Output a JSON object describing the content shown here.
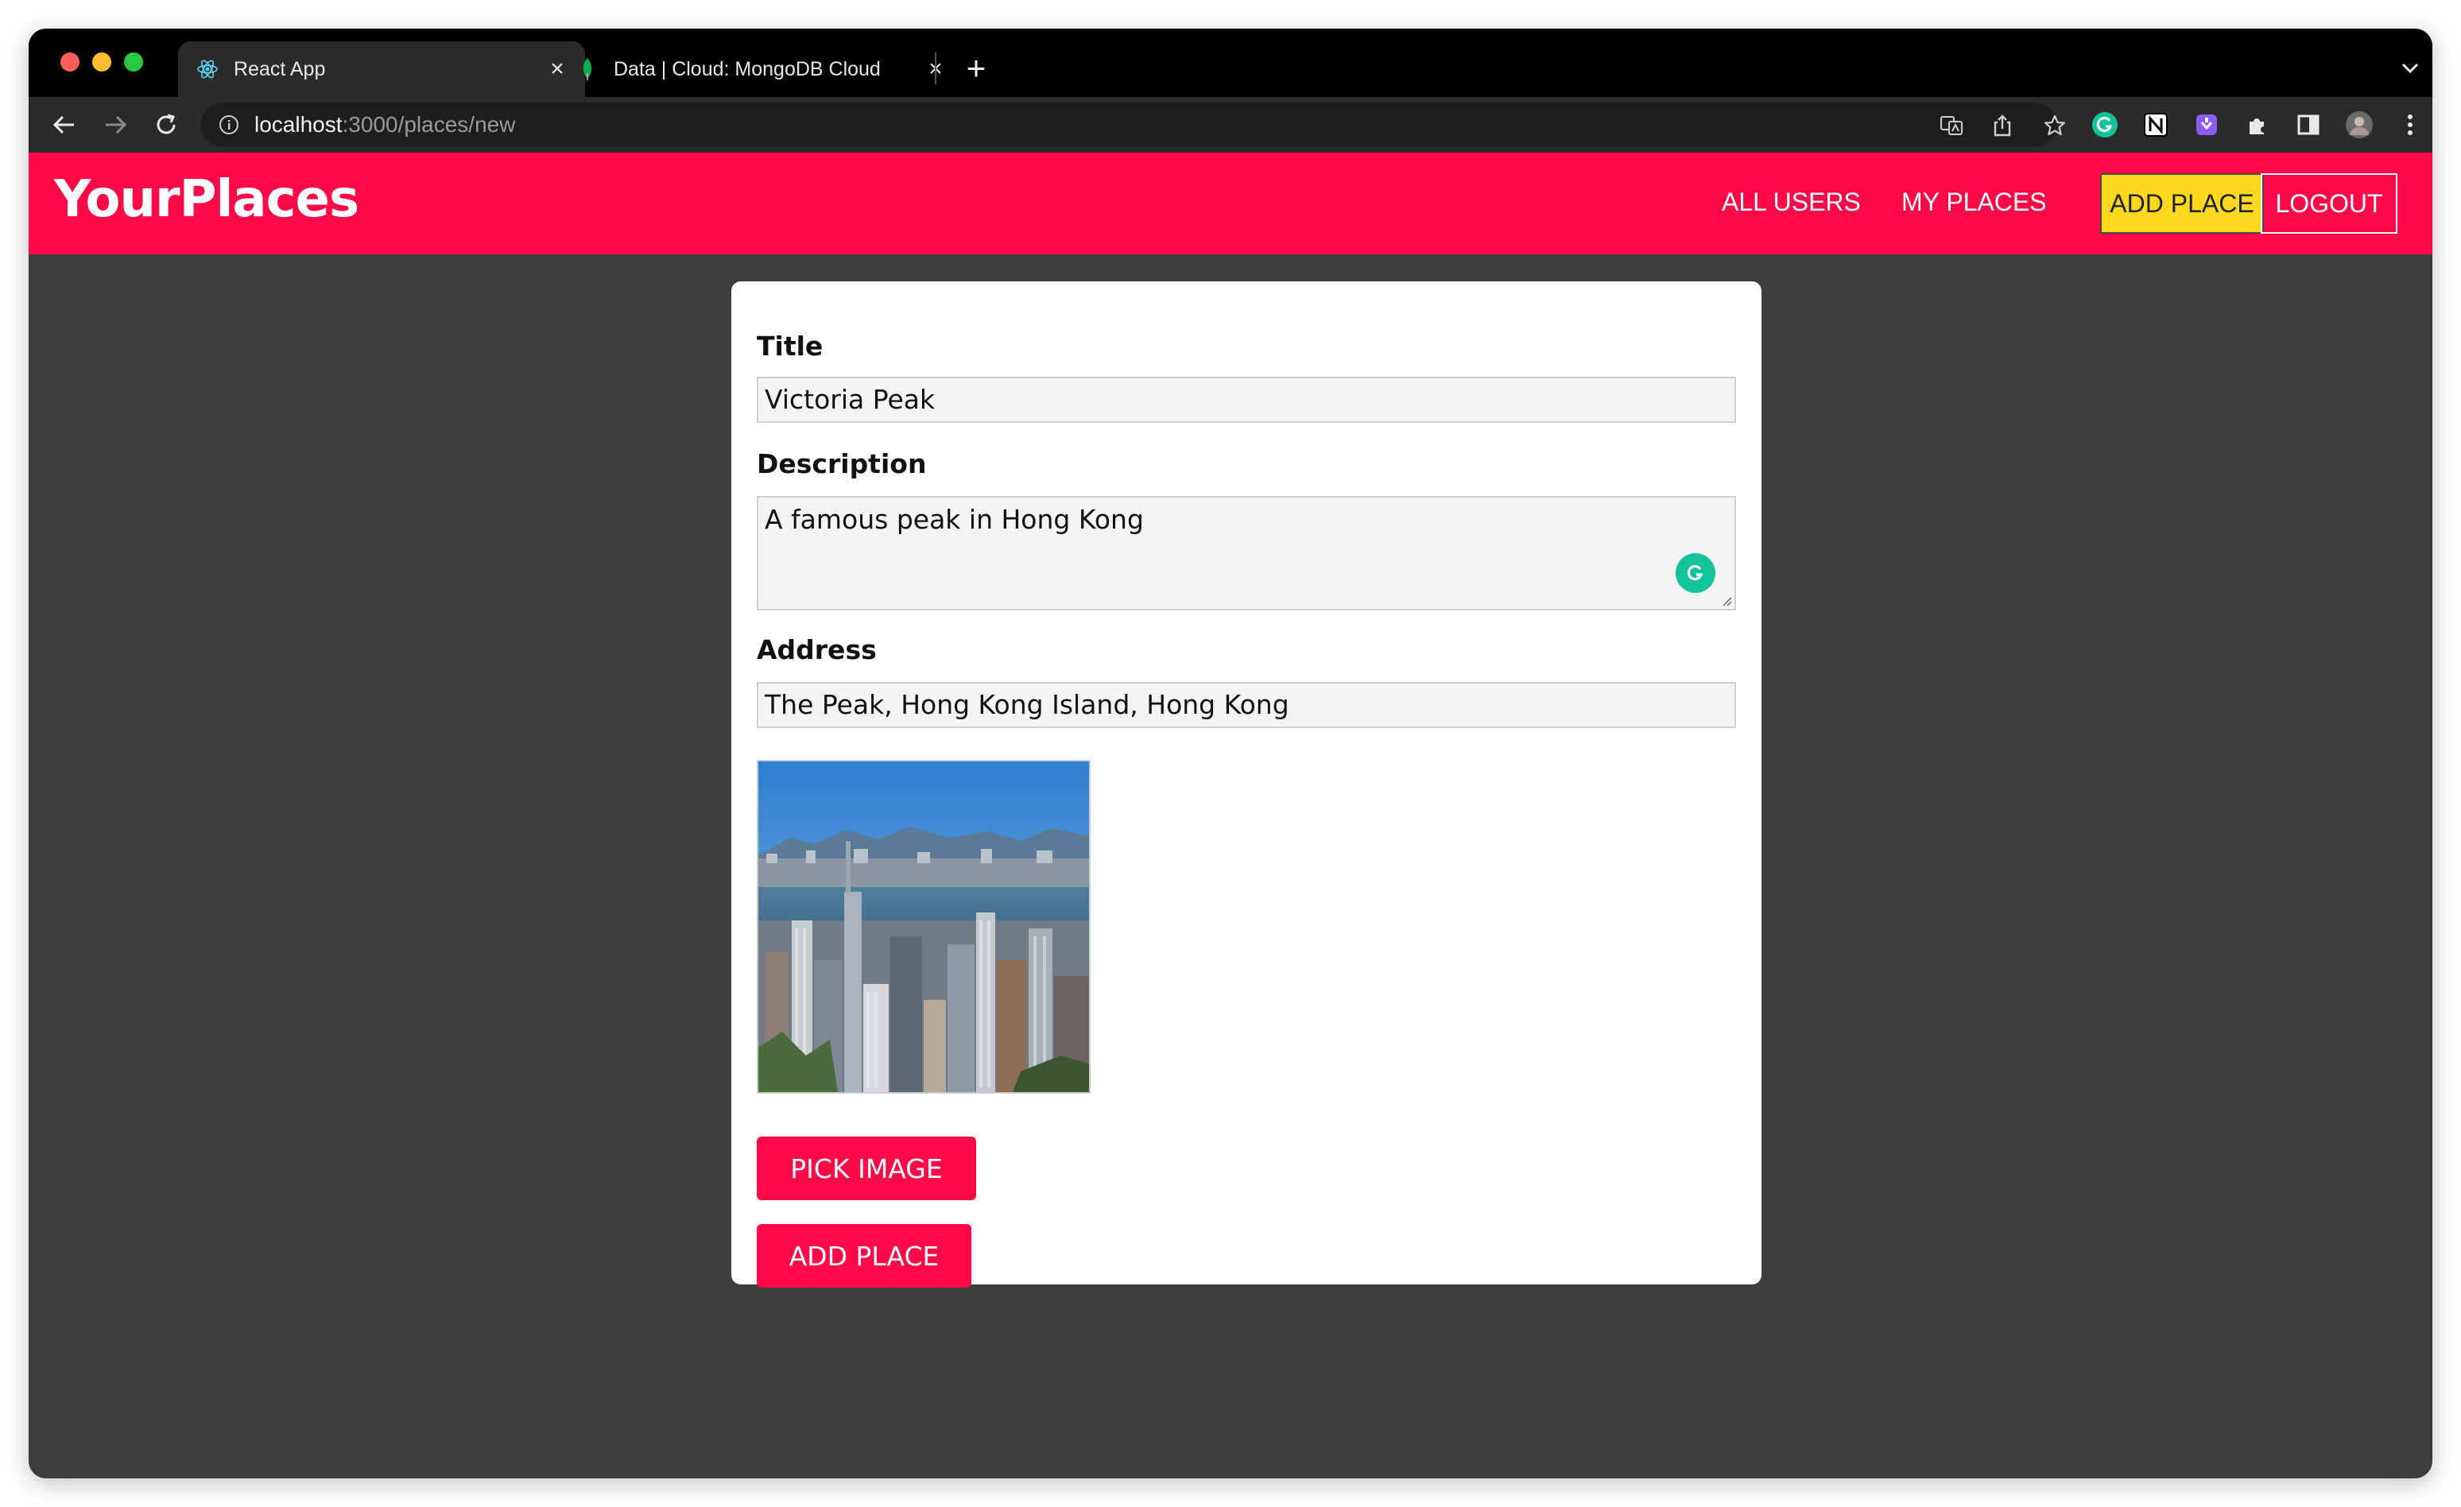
{
  "browser": {
    "tabs": [
      {
        "title": "React App",
        "favicon": "react-icon",
        "active": true
      },
      {
        "title": "Data | Cloud: MongoDB Cloud",
        "favicon": "mongodb-leaf-icon",
        "active": false
      }
    ],
    "url_host": "localhost",
    "url_path": ":3000/places/new",
    "colors": {
      "frame": "#000000",
      "toolbar": "#2b2b2b",
      "omnibox": "#1e1e1e"
    }
  },
  "header": {
    "logo": "YourPlaces",
    "nav": {
      "all_users": "ALL USERS",
      "my_places": "MY PLACES",
      "add_place": "ADD PLACE",
      "logout": "LOGOUT"
    },
    "colors": {
      "brand": "#ff0a48",
      "active_link": "#ffd81f"
    }
  },
  "form": {
    "title_label": "Title",
    "title_value": "Victoria Peak",
    "description_label": "Description",
    "description_value": "A famous peak in Hong Kong",
    "address_label": "Address",
    "address_value": "The Peak, Hong Kong Island, Hong Kong",
    "pick_image_label": "PICK IMAGE",
    "submit_label": "ADD PLACE"
  }
}
